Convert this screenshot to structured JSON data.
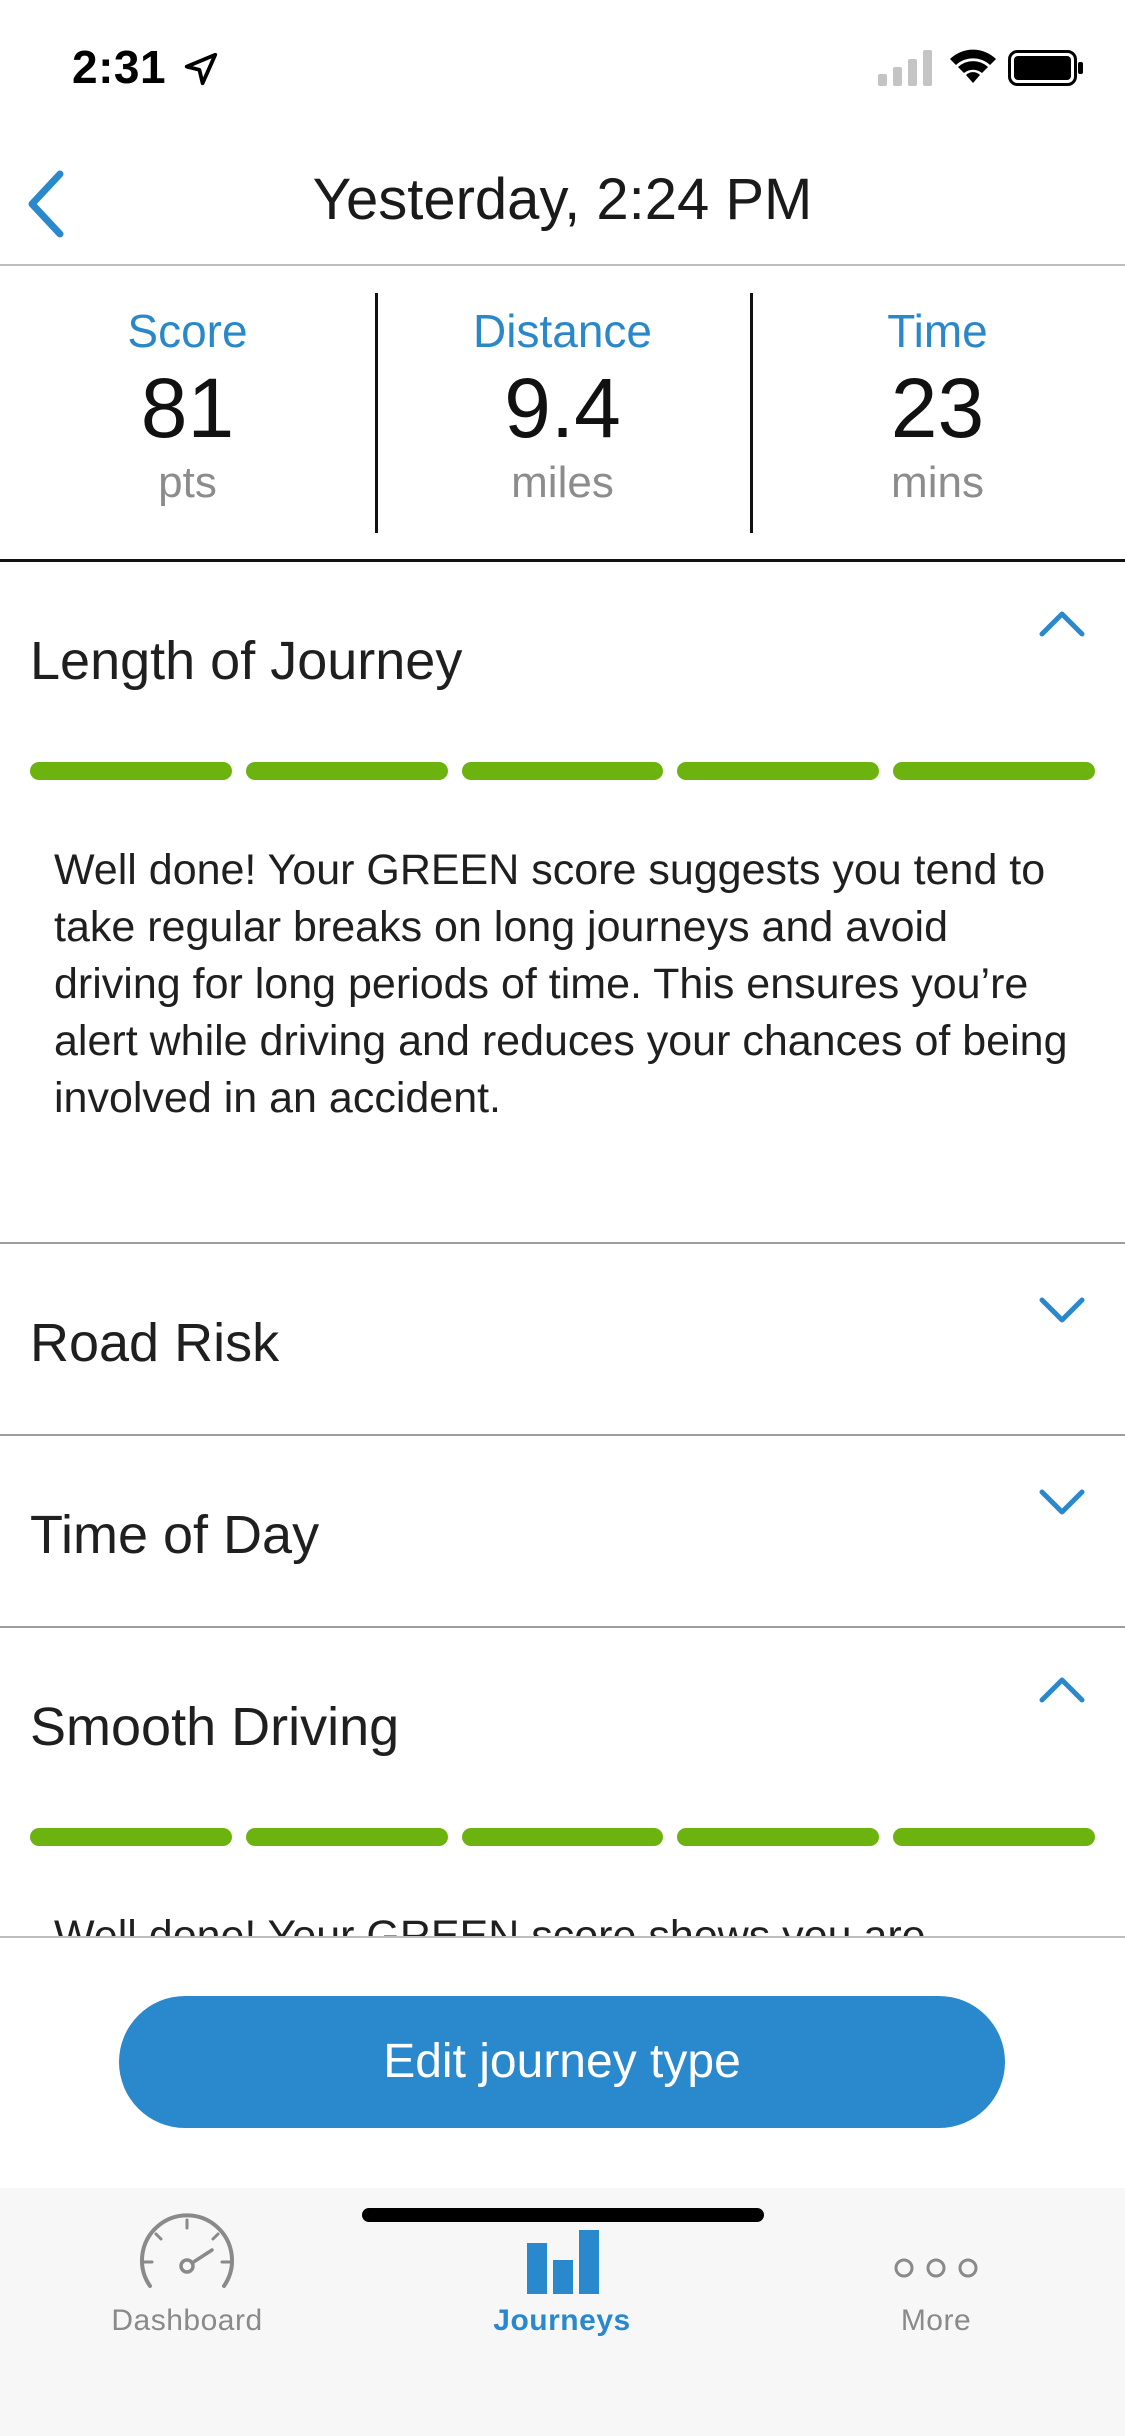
{
  "status_bar": {
    "time": "2:31"
  },
  "nav": {
    "title": "Yesterday, 2:24 PM"
  },
  "stats": [
    {
      "label": "Score",
      "value": "81",
      "unit": "pts"
    },
    {
      "label": "Distance",
      "value": "9.4",
      "unit": "miles"
    },
    {
      "label": "Time",
      "value": "23",
      "unit": "mins"
    }
  ],
  "sections": [
    {
      "title": "Length of Journey",
      "expanded": true,
      "text": "Well done! Your GREEN score suggests you tend to take regular breaks on long journeys and avoid driving for long periods of time. This ensures you’re alert while driving and reduces your chances of being involved in an accident."
    },
    {
      "title": "Road Risk",
      "expanded": false
    },
    {
      "title": "Time of Day",
      "expanded": false
    },
    {
      "title": "Smooth Driving",
      "expanded": true,
      "text": "Well done! Your GREEN score shows you are"
    }
  ],
  "score_bar_color": "#6db30f",
  "accent_color": "#2a88cd",
  "edit_button": {
    "label": "Edit journey type"
  },
  "tabs": [
    {
      "label": "Dashboard",
      "icon": "speedometer-icon",
      "active": false
    },
    {
      "label": "Journeys",
      "icon": "bar-chart-icon",
      "active": true
    },
    {
      "label": "More",
      "icon": "more-dots-icon",
      "active": false
    }
  ]
}
